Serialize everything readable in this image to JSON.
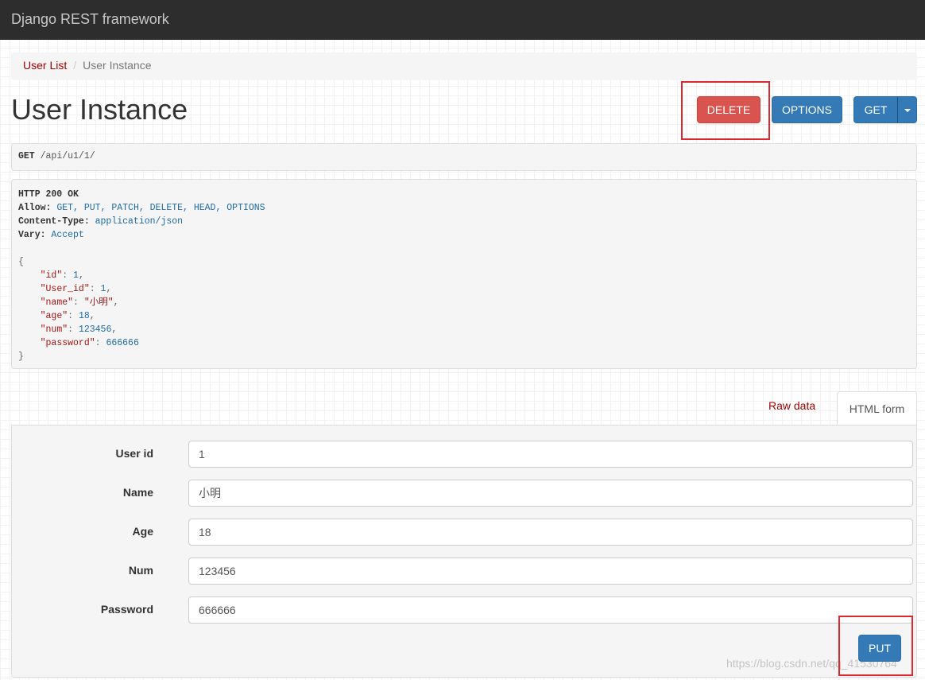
{
  "navbar": {
    "brand": "Django REST framework"
  },
  "breadcrumb": {
    "items": [
      "User List",
      "User Instance"
    ],
    "separator": "/"
  },
  "page": {
    "title": "User Instance"
  },
  "buttons": {
    "delete": "DELETE",
    "options": "OPTIONS",
    "get": "GET",
    "put": "PUT"
  },
  "request": {
    "method": "GET",
    "path": "/api/u1/1/"
  },
  "response": {
    "status": "HTTP 200 OK",
    "headers": [
      {
        "name": "Allow:",
        "value": "GET, PUT, PATCH, DELETE, HEAD, OPTIONS"
      },
      {
        "name": "Content-Type:",
        "value": "application/json"
      },
      {
        "name": "Vary:",
        "value": "Accept"
      }
    ],
    "body": {
      "open": "{",
      "close": "}",
      "fields": [
        {
          "key": "\"id\"",
          "value": "1",
          "comma": ","
        },
        {
          "key": "\"User_id\"",
          "value": "1",
          "comma": ","
        },
        {
          "key": "\"name\"",
          "value": "\"小明\"",
          "comma": ","
        },
        {
          "key": "\"age\"",
          "value": "18",
          "comma": ","
        },
        {
          "key": "\"num\"",
          "value": "123456",
          "comma": ","
        },
        {
          "key": "\"password\"",
          "value": "666666",
          "comma": ""
        }
      ]
    }
  },
  "tabs": {
    "raw": "Raw data",
    "html": "HTML form"
  },
  "form": {
    "fields": [
      {
        "label": "User id",
        "value": "1"
      },
      {
        "label": "Name",
        "value": "小明"
      },
      {
        "label": "Age",
        "value": "18"
      },
      {
        "label": "Num",
        "value": "123456"
      },
      {
        "label": "Password",
        "value": "666666"
      }
    ]
  },
  "watermark": "https://blog.csdn.net/qq_41530764",
  "colors": {
    "navbar": "#2d2d2d",
    "danger": "#d9534f",
    "primary": "#337ab7",
    "highlight": "#e0262e",
    "link": "#a30000"
  }
}
